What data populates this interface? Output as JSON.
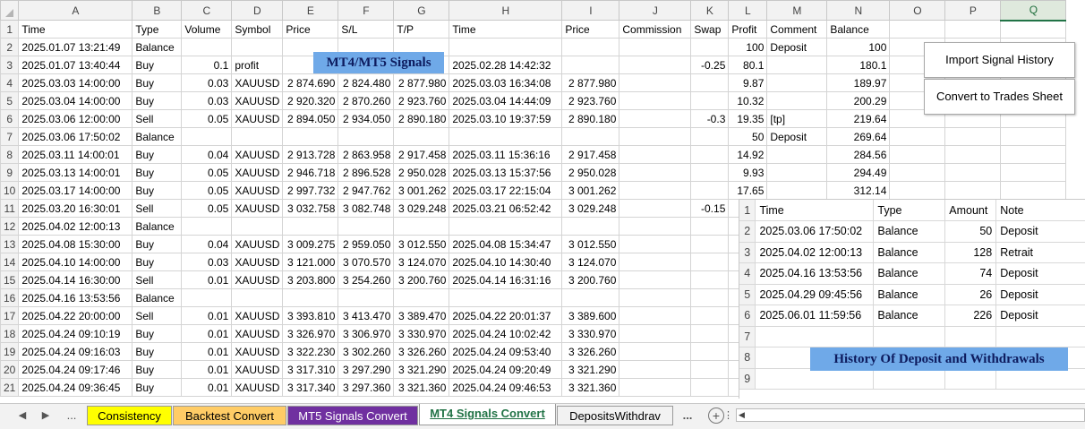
{
  "columns": [
    "A",
    "B",
    "C",
    "D",
    "E",
    "F",
    "G",
    "H",
    "I",
    "J",
    "K",
    "L",
    "M",
    "N",
    "O",
    "P",
    "Q"
  ],
  "rows": [
    {
      "n": "1",
      "c": [
        "Time",
        "Type",
        "Volume",
        "Symbol",
        "Price",
        "S/L",
        "T/P",
        "Time",
        "Price",
        "Commission",
        "Swap",
        "Profit",
        "Comment",
        "Balance",
        "",
        "",
        ""
      ]
    },
    {
      "n": "2",
      "c": [
        "2025.01.07 13:21:49",
        "Balance",
        "",
        "",
        "",
        "",
        "",
        "",
        "",
        "",
        "",
        "100",
        "Deposit",
        "100",
        "",
        "",
        ""
      ]
    },
    {
      "n": "3",
      "c": [
        "2025.01.07 13:40:44",
        "Buy",
        "0.1",
        "profit",
        "",
        "",
        "",
        "2025.02.28 14:42:32",
        "",
        "",
        "-0.25",
        "80.1",
        "",
        "180.1",
        "",
        "",
        ""
      ]
    },
    {
      "n": "4",
      "c": [
        "2025.03.03 14:00:00",
        "Buy",
        "0.03",
        "XAUUSD",
        "2 874.690",
        "2 824.480",
        "2 877.980",
        "2025.03.03 16:34:08",
        "2 877.980",
        "",
        "",
        "9.87",
        "",
        "189.97",
        "",
        "",
        ""
      ]
    },
    {
      "n": "5",
      "c": [
        "2025.03.04 14:00:00",
        "Buy",
        "0.03",
        "XAUUSD",
        "2 920.320",
        "2 870.260",
        "2 923.760",
        "2025.03.04 14:44:09",
        "2 923.760",
        "",
        "",
        "10.32",
        "",
        "200.29",
        "",
        "",
        ""
      ]
    },
    {
      "n": "6",
      "c": [
        "2025.03.06 12:00:00",
        "Sell",
        "0.05",
        "XAUUSD",
        "2 894.050",
        "2 934.050",
        "2 890.180",
        "2025.03.10 19:37:59",
        "2 890.180",
        "",
        "-0.3",
        "19.35",
        "[tp]",
        "219.64",
        "",
        "",
        ""
      ]
    },
    {
      "n": "7",
      "c": [
        "2025.03.06 17:50:02",
        "Balance",
        "",
        "",
        "",
        "",
        "",
        "",
        "",
        "",
        "",
        "50",
        "Deposit",
        "269.64",
        "",
        "",
        ""
      ]
    },
    {
      "n": "8",
      "c": [
        "2025.03.11 14:00:01",
        "Buy",
        "0.04",
        "XAUUSD",
        "2 913.728",
        "2 863.958",
        "2 917.458",
        "2025.03.11 15:36:16",
        "2 917.458",
        "",
        "",
        "14.92",
        "",
        "284.56",
        "",
        "",
        ""
      ]
    },
    {
      "n": "9",
      "c": [
        "2025.03.13 14:00:01",
        "Buy",
        "0.05",
        "XAUUSD",
        "2 946.718",
        "2 896.528",
        "2 950.028",
        "2025.03.13 15:37:56",
        "2 950.028",
        "",
        "",
        "9.93",
        "",
        "294.49",
        "",
        "",
        ""
      ]
    },
    {
      "n": "10",
      "c": [
        "2025.03.17 14:00:00",
        "Buy",
        "0.05",
        "XAUUSD",
        "2 997.732",
        "2 947.762",
        "3 001.262",
        "2025.03.17 22:15:04",
        "3 001.262",
        "",
        "",
        "17.65",
        "",
        "312.14",
        "",
        "",
        ""
      ]
    },
    {
      "n": "11",
      "c": [
        "2025.03.20 16:30:01",
        "Sell",
        "0.05",
        "XAUUSD",
        "3 032.758",
        "3 082.748",
        "3 029.248",
        "2025.03.21 06:52:42",
        "3 029.248",
        "",
        "-0.15",
        "",
        "",
        "",
        "",
        "",
        ""
      ]
    },
    {
      "n": "12",
      "c": [
        "2025.04.02 12:00:13",
        "Balance",
        "",
        "",
        "",
        "",
        "",
        "",
        "",
        "",
        "",
        "",
        "",
        "",
        "",
        "",
        ""
      ]
    },
    {
      "n": "13",
      "c": [
        "2025.04.08 15:30:00",
        "Buy",
        "0.04",
        "XAUUSD",
        "3 009.275",
        "2 959.050",
        "3 012.550",
        "2025.04.08 15:34:47",
        "3 012.550",
        "",
        "",
        "",
        "",
        "",
        "",
        "",
        ""
      ]
    },
    {
      "n": "14",
      "c": [
        "2025.04.10 14:00:00",
        "Buy",
        "0.03",
        "XAUUSD",
        "3 121.000",
        "3 070.570",
        "3 124.070",
        "2025.04.10 14:30:40",
        "3 124.070",
        "",
        "",
        "",
        "",
        "",
        "",
        "",
        ""
      ]
    },
    {
      "n": "15",
      "c": [
        "2025.04.14 16:30:00",
        "Sell",
        "0.01",
        "XAUUSD",
        "3 203.800",
        "3 254.260",
        "3 200.760",
        "2025.04.14 16:31:16",
        "3 200.760",
        "",
        "",
        "",
        "",
        "",
        "",
        "",
        ""
      ]
    },
    {
      "n": "16",
      "c": [
        "2025.04.16 13:53:56",
        "Balance",
        "",
        "",
        "",
        "",
        "",
        "",
        "",
        "",
        "",
        "",
        "",
        "",
        "",
        "",
        ""
      ]
    },
    {
      "n": "17",
      "c": [
        "2025.04.22 20:00:00",
        "Sell",
        "0.01",
        "XAUUSD",
        "3 393.810",
        "3 413.470",
        "3 389.470",
        "2025.04.22 20:01:37",
        "3 389.600",
        "",
        "",
        "",
        "",
        "",
        "",
        "",
        ""
      ]
    },
    {
      "n": "18",
      "c": [
        "2025.04.24 09:10:19",
        "Buy",
        "0.01",
        "XAUUSD",
        "3 326.970",
        "3 306.970",
        "3 330.970",
        "2025.04.24 10:02:42",
        "3 330.970",
        "",
        "",
        "",
        "",
        "",
        "",
        "",
        ""
      ]
    },
    {
      "n": "19",
      "c": [
        "2025.04.24 09:16:03",
        "Buy",
        "0.01",
        "XAUUSD",
        "3 322.230",
        "3 302.260",
        "3 326.260",
        "2025.04.24 09:53:40",
        "3 326.260",
        "",
        "",
        "",
        "",
        "",
        "",
        "",
        ""
      ]
    },
    {
      "n": "20",
      "c": [
        "2025.04.24 09:17:46",
        "Buy",
        "0.01",
        "XAUUSD",
        "3 317.310",
        "3 297.290",
        "3 321.290",
        "2025.04.24 09:20:49",
        "3 321.290",
        "",
        "",
        "",
        "",
        "",
        "",
        "",
        ""
      ]
    },
    {
      "n": "21",
      "c": [
        "2025.04.24 09:36:45",
        "Buy",
        "0.01",
        "XAUUSD",
        "3 317.340",
        "3 297.360",
        "3 321.360",
        "2025.04.24 09:46:53",
        "3 321.360",
        "",
        "",
        "",
        "",
        "",
        "",
        "",
        ""
      ]
    }
  ],
  "signals_label": "MT4/MT5 Signals",
  "buttons": {
    "import": "Import Signal History",
    "convert": "Convert to Trades Sheet"
  },
  "inset": {
    "rows": [
      {
        "n": "1",
        "c": [
          "Time",
          "Type",
          "Amount",
          "Note"
        ]
      },
      {
        "n": "2",
        "c": [
          "2025.03.06 17:50:02",
          "Balance",
          "50",
          "Deposit"
        ]
      },
      {
        "n": "3",
        "c": [
          "2025.04.02 12:00:13",
          "Balance",
          "128",
          "Retrait"
        ]
      },
      {
        "n": "4",
        "c": [
          "2025.04.16 13:53:56",
          "Balance",
          "74",
          "Deposit"
        ]
      },
      {
        "n": "5",
        "c": [
          "2025.04.29 09:45:56",
          "Balance",
          "26",
          "Deposit"
        ]
      },
      {
        "n": "6",
        "c": [
          "2025.06.01 11:59:56",
          "Balance",
          "226",
          "Deposit"
        ]
      },
      {
        "n": "7",
        "c": [
          "",
          "",
          "",
          ""
        ]
      },
      {
        "n": "8",
        "c": [
          "",
          "",
          "",
          ""
        ]
      },
      {
        "n": "9",
        "c": [
          "",
          "",
          "",
          ""
        ]
      }
    ],
    "label": "History Of Deposit and Withdrawals"
  },
  "tabs": [
    {
      "label": "Consistency",
      "bg": "#ffff00",
      "color": "#000000"
    },
    {
      "label": "Backtest Convert",
      "bg": "#ffcc66",
      "color": "#000000"
    },
    {
      "label": "MT5 Signals Convert",
      "bg": "#7030a0",
      "color": "#ffffff"
    },
    {
      "label": "MT4 Signals Convert",
      "bg": "#ffffff",
      "color": "#217346",
      "active": true
    },
    {
      "label": "DepositsWithdrav",
      "bg": "#f2f2f2",
      "color": "#000000"
    }
  ],
  "nav": {
    "prev": "◀",
    "next": "▶",
    "more": "...",
    "more2": "...",
    "add": "+",
    "sep": "⋮"
  }
}
